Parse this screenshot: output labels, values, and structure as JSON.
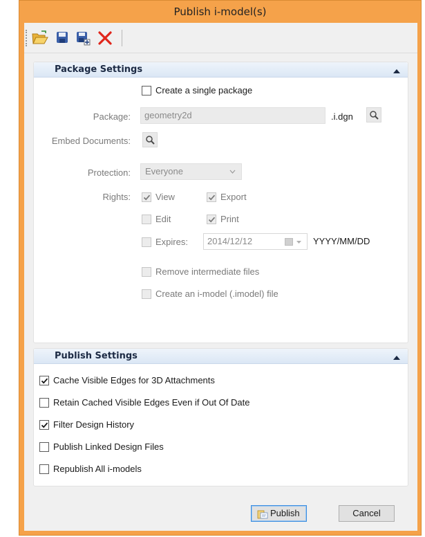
{
  "window": {
    "title": "Publish i-model(s)"
  },
  "toolbar": {
    "buttons": [
      {
        "name": "open-folder-icon"
      },
      {
        "name": "save-icon"
      },
      {
        "name": "save-as-icon"
      },
      {
        "name": "delete-icon"
      }
    ]
  },
  "package_settings": {
    "header": "Package Settings",
    "single_package_label": "Create a single package",
    "single_package_checked": false,
    "package_label": "Package:",
    "package_value": "geometry2d",
    "package_suffix": ".i.dgn",
    "embed_label": "Embed Documents:",
    "protection_label": "Protection:",
    "protection_value": "Everyone",
    "rights_label": "Rights:",
    "rights": {
      "view": {
        "label": "View",
        "checked": true
      },
      "export": {
        "label": "Export",
        "checked": true
      },
      "edit": {
        "label": "Edit",
        "checked": false
      },
      "print": {
        "label": "Print",
        "checked": true
      }
    },
    "expires_label": "Expires:",
    "expires_value": "2014/12/12",
    "date_format": "YYYY/MM/DD",
    "remove_intermediate_label": "Remove intermediate files",
    "create_imodel_label": "Create an i-model (.imodel) file"
  },
  "publish_settings": {
    "header": "Publish Settings",
    "options": [
      {
        "label": "Cache Visible Edges for 3D Attachments",
        "checked": true
      },
      {
        "label": "Retain Cached Visible Edges Even if Out Of Date",
        "checked": false
      },
      {
        "label": "Filter Design History",
        "checked": true
      },
      {
        "label": "Publish Linked Design Files",
        "checked": false
      },
      {
        "label": "Republish All i-models",
        "checked": false
      }
    ]
  },
  "buttons": {
    "publish": "Publish",
    "cancel": "Cancel"
  },
  "colors": {
    "window_frame": "#f5a24a",
    "panel_header": "#dbe7f5",
    "delete_red": "#e0261b"
  }
}
